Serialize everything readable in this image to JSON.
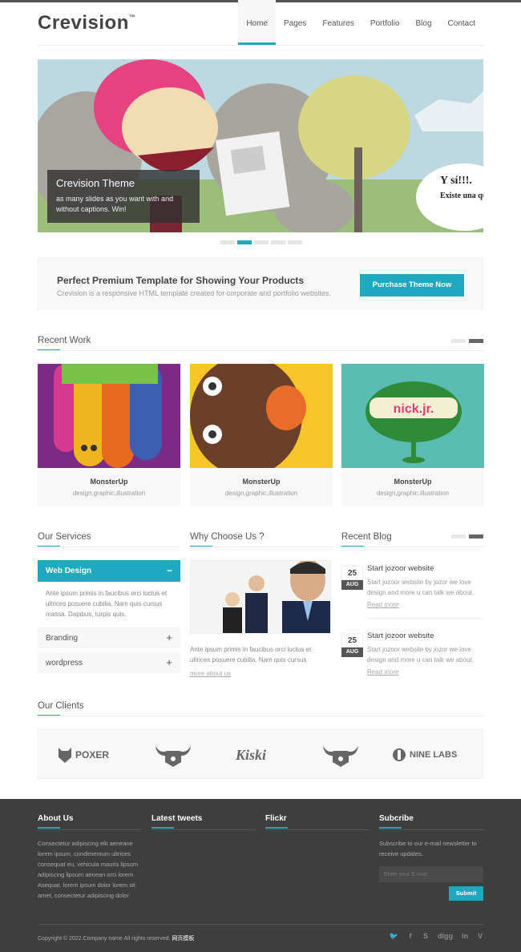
{
  "brand": {
    "name": "Crevision",
    "tm": "™"
  },
  "nav": [
    {
      "label": "Home"
    },
    {
      "label": "Pages"
    },
    {
      "label": "Features"
    },
    {
      "label": "Portfolio"
    },
    {
      "label": "Blog"
    },
    {
      "label": "Contact"
    }
  ],
  "slider": {
    "title": "Crevision Theme",
    "text": "as many slides as you want with and without captions. Win!",
    "bubble_main": "Y sí!!!.",
    "bubble_sub": "Existe una que se rie"
  },
  "promo": {
    "heading": "Perfect Premium Template for Showing Your Products",
    "sub": "Crevision is a responsive HTML template created for corporate and portfolio websites.",
    "button": "Purchase Theme Now"
  },
  "recent_work": {
    "title": "Recent Work",
    "items": [
      {
        "name": "MonsterUp",
        "cats": "design,graphic,illustration"
      },
      {
        "name": "MonsterUp",
        "cats": "design,graphic,illustration"
      },
      {
        "name": "MonsterUp",
        "cats": "design,graphic,illustration"
      }
    ]
  },
  "art": {
    "nick": "nick.jr."
  },
  "services": {
    "title": "Our Services",
    "active": "Web Design",
    "active_toggle": "−",
    "body": "Ante ipsum primis in faucibus orci luctus et ultrices posuere cubilia. Nam quis cursus massa. Dapibus, turpis quis.",
    "items": [
      {
        "label": "Branding",
        "toggle": "+"
      },
      {
        "label": "wordpress",
        "toggle": "+"
      }
    ]
  },
  "why": {
    "title": "Why Choose Us ?",
    "text": "Ante ipsum primis in faucibus orci luctus et ultrices posuere cubilia. Nam quis cursus",
    "more": "more about us"
  },
  "blog": {
    "title": "Recent Blog",
    "posts": [
      {
        "day": "25",
        "month": "AUG",
        "title": "Start jozoor website",
        "excerpt": "Start jozoor website by jozor we love design and more u can talk we about.",
        "more": "Read more"
      },
      {
        "day": "25",
        "month": "AUG",
        "title": "Start jozoor website",
        "excerpt": "Start jozoor website by jozor we love design and more u can talk we about.",
        "more": "Read more"
      }
    ]
  },
  "clients": {
    "title": "Our Clients",
    "logos": [
      "POXER",
      "",
      "Kiski",
      "",
      "NINE LABS"
    ]
  },
  "footer": {
    "about_title": "About Us",
    "about_text": "Consectetur adipiscing elit aeneane lorem ipsum, condimentum ultrices consequat eu, vehicula mauris lipsum adipiscing lipsum aenean orci lorem Asequat. lorem ipsum dolor lorem sit amet, consectetur adipiscing dolor",
    "tweets_title": "Latest tweets",
    "flickr_title": "Flickr",
    "sub_title": "Subcribe",
    "sub_text": "Subscribe to our e-mail newsletter to receive updates.",
    "email_placeholder": "Enter your E-mail",
    "submit": "Submit",
    "copyright": "Copyright © 2022.Company name All rights reserved.",
    "copyright_link": "网页模板",
    "social": [
      "twitter-icon",
      "facebook-icon",
      "skype-icon",
      "digg-icon",
      "linkedin-icon",
      "vimeo-icon"
    ],
    "social_glyphs": [
      "🐦",
      "f",
      "S",
      "digg",
      "in",
      "V"
    ]
  },
  "colors": {
    "accent": "#1fa9c1",
    "dark": "#3e3e3e"
  }
}
